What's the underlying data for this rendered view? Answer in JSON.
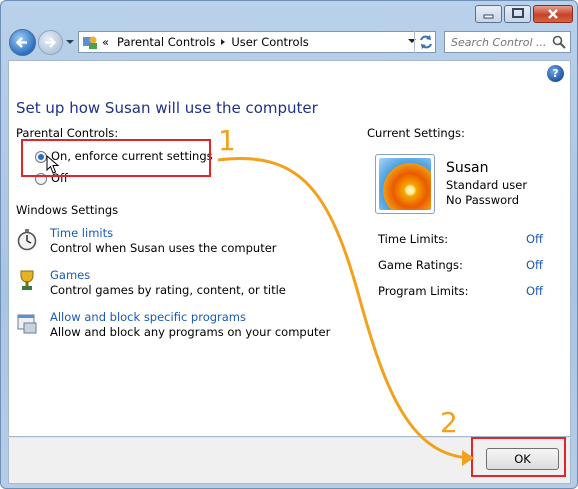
{
  "window": {
    "breadcrumb_prefix": "«",
    "breadcrumb": [
      "Parental Controls",
      "User Controls"
    ],
    "search_placeholder": "Search Control ..."
  },
  "heading": "Set up how Susan will use the computer",
  "parental_controls": {
    "label": "Parental Controls:",
    "options": [
      {
        "label": "On, enforce current settings",
        "selected": true
      },
      {
        "label": "Off",
        "selected": false
      }
    ]
  },
  "windows_settings": {
    "label": "Windows Settings",
    "items": [
      {
        "link": "Time limits",
        "desc": "Control when Susan uses the computer",
        "icon": "stopwatch-icon"
      },
      {
        "link": "Games",
        "desc": "Control games by rating, content, or title",
        "icon": "games-trophy-icon"
      },
      {
        "link": "Allow and block specific programs",
        "desc": "Allow and block any programs on your computer",
        "icon": "programs-icon"
      }
    ]
  },
  "current_settings": {
    "label": "Current Settings:",
    "user_name": "Susan",
    "user_type": "Standard user",
    "password": "No Password",
    "limits": [
      {
        "label": "Time Limits:",
        "value": "Off"
      },
      {
        "label": "Game Ratings:",
        "value": "Off"
      },
      {
        "label": "Program Limits:",
        "value": "Off"
      }
    ]
  },
  "ok_label": "OK",
  "annotations": {
    "step1": "1",
    "step2": "2",
    "color": "#f2a11f",
    "highlight": "#e0262a"
  }
}
